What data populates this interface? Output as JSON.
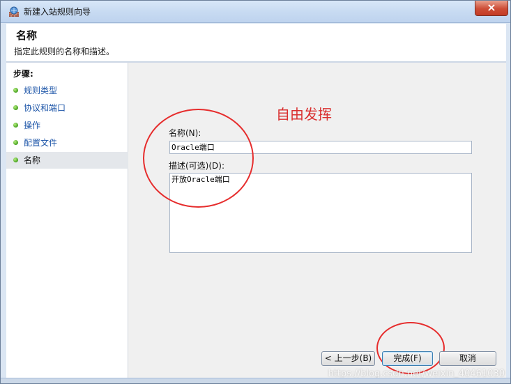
{
  "window": {
    "title": "新建入站规则向导",
    "close_label": "×",
    "bg_title_ghost": "   "
  },
  "header": {
    "title": "名称",
    "subtitle": "指定此规则的名称和描述。"
  },
  "steps": {
    "title": "步骤:",
    "items": [
      {
        "label": "规则类型"
      },
      {
        "label": "协议和端口"
      },
      {
        "label": "操作"
      },
      {
        "label": "配置文件"
      },
      {
        "label": "名称"
      }
    ]
  },
  "form": {
    "overlay_note": "自由发挥",
    "name_label": "名称(N):",
    "name_value": "Oracle端口",
    "description_label": "描述(可选)(D):",
    "description_value": "开放Oracle端口"
  },
  "buttons": {
    "back": "< 上一步(B)",
    "finish": "完成(F)",
    "cancel": "取消"
  },
  "watermark": {
    "text": "https://blog.csdn.net/weixin_40461030"
  },
  "colors": {
    "annotation": "#e62d2d",
    "link": "#1c55a8",
    "step_dot": "#3d9a18"
  },
  "icons": {
    "app": "firewall-wizard-icon",
    "close": "close-icon",
    "step": "green-dot-icon"
  }
}
